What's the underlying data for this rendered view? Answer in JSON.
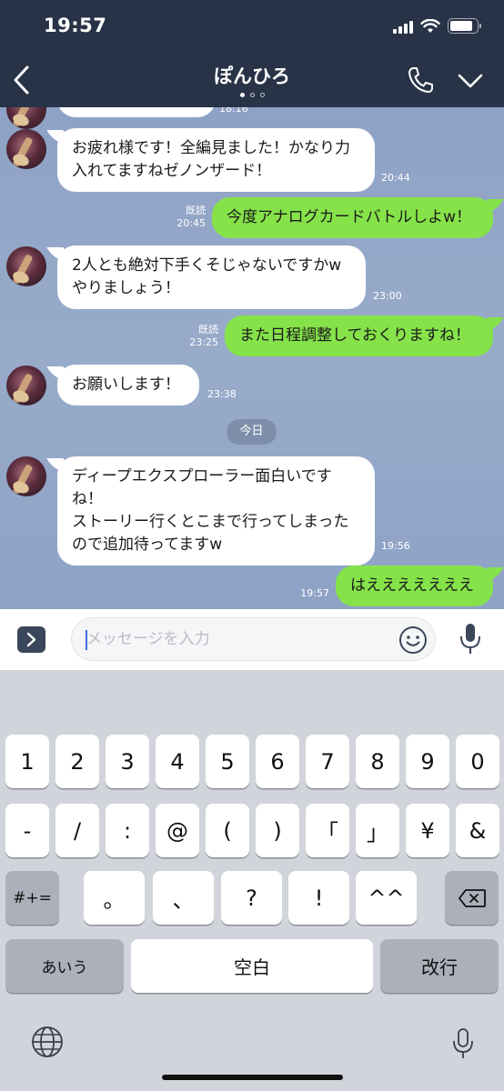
{
  "status_bar": {
    "time": "19:57",
    "battery_level": 0.85
  },
  "header": {
    "title": "ぽんひろ",
    "page_indicator": {
      "total": 3,
      "active": 0
    }
  },
  "chat": {
    "date_separator": "今日",
    "messages": [
      {
        "direction": "in",
        "text": "",
        "time": "18:16"
      },
      {
        "direction": "in",
        "text": "お疲れ様です！全編見ました！かなり力\n入れてますねゼノンザード！",
        "time": "20:44"
      },
      {
        "direction": "out",
        "text": "今度アナログカードバトルしよw！",
        "read": "既読",
        "time": "20:45"
      },
      {
        "direction": "in",
        "text": "2人とも絶対下手くそじゃないですかw\nやりましょう！",
        "time": "23:00"
      },
      {
        "direction": "out",
        "text": "また日程調整しておくりますね！",
        "read": "既読",
        "time": "23:25"
      },
      {
        "direction": "in",
        "text": "お願いします！",
        "time": "23:38"
      },
      {
        "direction": "in",
        "text": "ディープエクスプローラー面白いです\nね！\nストーリー行くとこまで行ってしまった\nので追加待ってますw",
        "time": "19:56"
      },
      {
        "direction": "out",
        "text": "はえええええええ",
        "time": "19:57"
      }
    ]
  },
  "input": {
    "placeholder": "メッセージを入力",
    "value": ""
  },
  "keyboard": {
    "row1": [
      "1",
      "2",
      "3",
      "4",
      "5",
      "6",
      "7",
      "8",
      "9",
      "0"
    ],
    "row2": [
      "-",
      "/",
      ":",
      "@",
      "(",
      ")",
      "「",
      "」",
      "¥",
      "&"
    ],
    "row3": [
      "#+=",
      "。",
      "、",
      "?",
      "!",
      "^^"
    ],
    "row4": {
      "mode": "あいう",
      "space": "空白",
      "return": "改行"
    }
  },
  "colors": {
    "header_bg": "#283347",
    "chat_bg": "#8ea2c6",
    "bubble_out": "#85e249",
    "bubble_in": "#ffffff",
    "keyboard_bg": "#d1d4da"
  }
}
